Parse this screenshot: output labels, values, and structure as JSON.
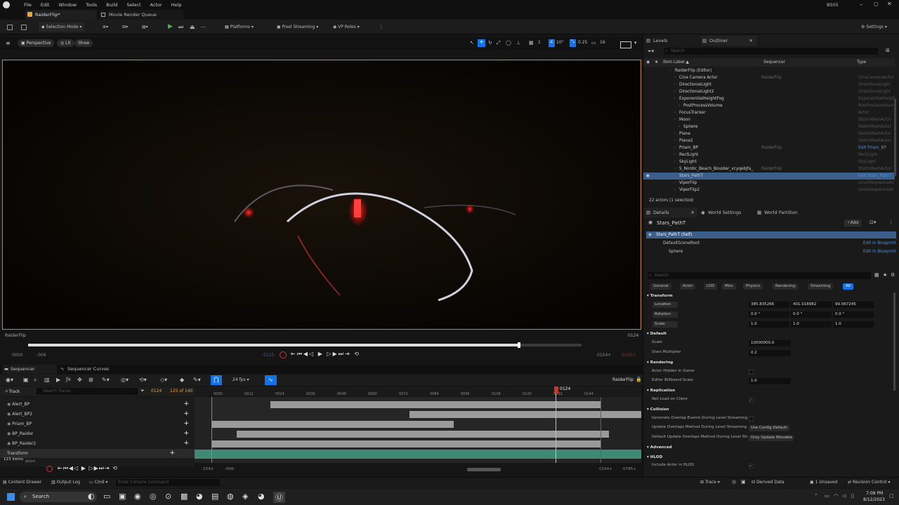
{
  "menu": {
    "items": [
      "File",
      "Edit",
      "Window",
      "Tools",
      "Build",
      "Select",
      "Actor",
      "Help"
    ],
    "project": "BS05"
  },
  "tabs": [
    {
      "label": "RaiderFlip*"
    },
    {
      "label": "Movie Render Queue"
    }
  ],
  "toolbar": {
    "selection_mode": "Selection Mode",
    "platforms": "Platforms",
    "pixel_streaming": "Pixel Streaming",
    "vp_roles": "VP Roles",
    "settings": "Settings"
  },
  "viewport": {
    "perspective": "Perspective",
    "lit": "Lit",
    "show": "Show",
    "snap_angle": "10°",
    "snap_scale": "0.25",
    "camera_speed": "16",
    "grid": "1",
    "shot_name": "RaiderFlip",
    "current_frame": "0124",
    "playback_fill_fraction": 0.887
  },
  "transport": {
    "start": "0000",
    "start_minus": "-006",
    "in_marker": "0125",
    "out_frame": "0154+",
    "out_end": "0190+"
  },
  "sequencer": {
    "tabs": [
      "Sequencer",
      "Sequencer Curves"
    ],
    "fps": "24 fps",
    "sequence_name": "RaiderFlip",
    "add_track": "Track",
    "search_placeholder": "Search Tracks",
    "frame": "0124",
    "frame_range": "125 of 140",
    "ruler": [
      "0000",
      "0012",
      "0024",
      "0036",
      "0048",
      "0060",
      "0072",
      "0084",
      "0096",
      "0108",
      "0120",
      "0132",
      "0144"
    ],
    "playhead_label": "0124",
    "tracks": [
      {
        "label": "Alert_BP"
      },
      {
        "label": "Alert_BP2"
      },
      {
        "label": "Priam_BP"
      },
      {
        "label": "BP_Raider"
      },
      {
        "label": "BP_Raider2"
      },
      {
        "label": "Transform"
      }
    ],
    "items_count": "123 items",
    "items_sub": "ation",
    "bottom_start": "-1542-",
    "bottom_start2": "-006-",
    "bottom_end": "0154+",
    "bottom_end2": "0785+"
  },
  "levels_tab": "Levels",
  "outliner": {
    "title": "Outliner",
    "search_placeholder": "Search",
    "col_label": "Item Label ▲",
    "col_seq": "Sequencer",
    "col_type": "Type",
    "rows": [
      {
        "label": "RaiderFlip (Editor)",
        "seq": "",
        "type": ""
      },
      {
        "label": "Cine Camera Actor",
        "seq": "RaiderFlip",
        "type": "CineCameraActor"
      },
      {
        "label": "DirectionalLight",
        "seq": "",
        "type": "DirectionalLight"
      },
      {
        "label": "DirectionalLight2",
        "seq": "",
        "type": "DirectionalLight"
      },
      {
        "label": "ExponentialHeightFog",
        "seq": "",
        "type": "ExponentialHeight"
      },
      {
        "label": "PostProcessVolume",
        "seq": "",
        "type": "PostProcessVolum"
      },
      {
        "label": "FocusTracker",
        "seq": "",
        "type": "Actor"
      },
      {
        "label": "Moon",
        "seq": "",
        "type": "StaticMeshActor"
      },
      {
        "label": "Sphere",
        "seq": "",
        "type": "StaticMeshActor"
      },
      {
        "label": "Plane",
        "seq": "",
        "type": "StaticMeshActor"
      },
      {
        "label": "Plane2",
        "seq": "",
        "type": "StaticMeshActor"
      },
      {
        "label": "Priam_BP",
        "seq": "RaiderFlip",
        "type": "Edit Priam_BP"
      },
      {
        "label": "RectLight",
        "seq": "",
        "type": "RectLight"
      },
      {
        "label": "SkyLight",
        "seq": "",
        "type": "SkyLight"
      },
      {
        "label": "S_Nordic_Beach_Boulder_vcyqebjfa_",
        "seq": "RaiderFlip",
        "type": "StaticMeshActor"
      },
      {
        "label": "Stars_PathT",
        "seq": "",
        "type": "Edit Stars_PathT"
      },
      {
        "label": "ViperFlip",
        "seq": "",
        "type": "LevelSequenceAc"
      },
      {
        "label": "ViperFlip2",
        "seq": "",
        "type": "LevelSequenceAc"
      }
    ],
    "footer": "22 actors (1 selected)"
  },
  "details": {
    "tabs": [
      "Details",
      "World Settings",
      "World Partition"
    ],
    "actor_name": "Stars_PathT",
    "add": "Add",
    "self_label": "Stars_PathT (Self)",
    "components": [
      {
        "label": "DefaultSceneRoot",
        "link": "Edit in Blueprint"
      },
      {
        "label": "Sphere",
        "link": "Edit in Blueprint"
      }
    ],
    "search_placeholder": "Search",
    "filters": [
      "General",
      "Actor",
      "LOD",
      "Misc",
      "Physics",
      "Rendering",
      "Streaming",
      "All"
    ],
    "sections": {
      "transform": "Transform",
      "default": "Default",
      "rendering": "Rendering",
      "replication": "Replication",
      "collision": "Collision",
      "advanced": "Advanced",
      "hlod": "HLOD"
    },
    "location_label": "Location",
    "location": [
      "385.835266",
      "401.018982",
      "99.067245"
    ],
    "rotation_label": "Rotation",
    "rotation": [
      "0.0 °",
      "0.0 °",
      "0.0 °"
    ],
    "scale_label": "Scale",
    "scale": [
      "1.0",
      "1.0",
      "1.0"
    ],
    "default_scale_label": "Scale",
    "default_scale": "10000000.0",
    "stars_multiplier_label": "Stars Multiplier",
    "stars_multiplier": "0.2",
    "actor_hidden": "Actor Hidden in Game",
    "editor_billboard": "Editor Billboard Scale",
    "editor_billboard_value": "1.0",
    "net_load": "Net Load on Client",
    "gen_overlap": "Generate Overlap Events During Level Streaming",
    "update_overlap": "Update Overlaps Method During Level Streaming",
    "update_overlap_value": "Use Config Default",
    "default_update_overlap": "Default Update Overlaps Method During Level Str...",
    "default_update_overlap_value": "Only Update Movable",
    "include_hlod": "Include Actor in HLOD"
  },
  "status": {
    "content_drawer": "Content Drawer",
    "output_log": "Output Log",
    "cmd": "Cmd",
    "console_placeholder": "Enter Console Command",
    "trace": "Trace",
    "derived_data": "Derived Data",
    "unsaved": "1 Unsaved",
    "revision_control": "Revision Control"
  },
  "taskbar": {
    "search": "Search",
    "time": "7:08 PM",
    "date": "8/12/2023"
  },
  "colors": {
    "selection": "#3b5f8a",
    "accent_blue": "#1473e6",
    "viewport_border": "#c78a2a",
    "play_green": "#4caf50"
  }
}
